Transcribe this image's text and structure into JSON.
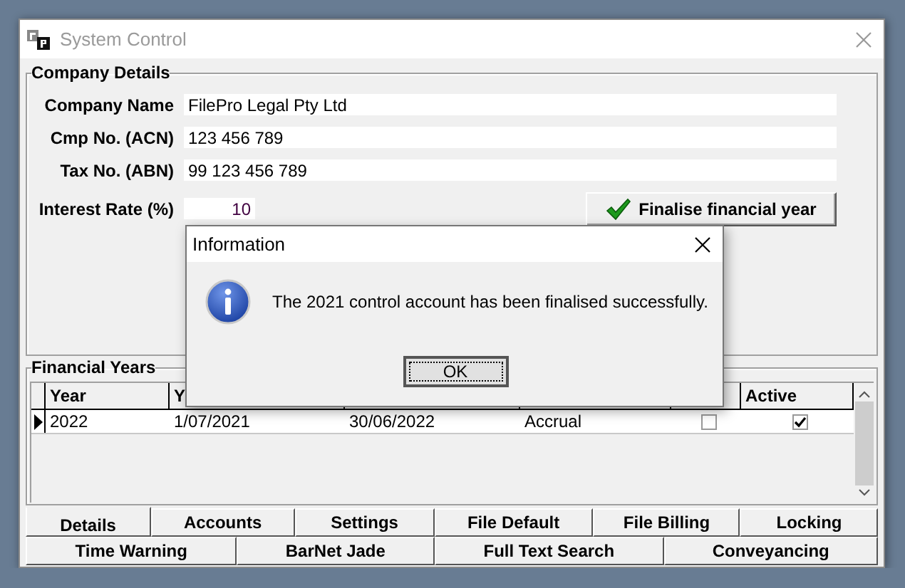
{
  "window": {
    "title": "System Control"
  },
  "company_details": {
    "title": "Company Details",
    "fields": [
      {
        "label": "Company Name",
        "value": "FilePro Legal Pty Ltd",
        "kind": "wide"
      },
      {
        "label": "Cmp No. (ACN)",
        "value": "123 456 789",
        "kind": "wide"
      },
      {
        "label": "Tax No. (ABN)",
        "value": "99 123 456 789",
        "kind": "wide"
      },
      {
        "label": "Interest Rate (%)",
        "value": "10",
        "kind": "number"
      }
    ],
    "finalise_button": {
      "label": "Finalise financial year"
    }
  },
  "financial_years": {
    "title": "Financial Years",
    "columns": [
      {
        "header": "Year"
      },
      {
        "header": "Y"
      },
      {},
      {},
      {},
      {
        "header": "Active"
      }
    ],
    "rows": [
      {
        "current": true,
        "cells": [
          {
            "kind": "text",
            "text": "2022"
          },
          {
            "kind": "text",
            "text": "1/07/2021"
          },
          {
            "kind": "text",
            "text": "30/06/2022"
          },
          {
            "kind": "text",
            "text": "Accrual"
          },
          {
            "kind": "check",
            "checked": false
          },
          {
            "kind": "check",
            "checked": true
          }
        ]
      }
    ]
  },
  "tab_rows": [
    [
      {
        "label": "Details",
        "selected": true
      },
      {
        "label": "Accounts",
        "selected": false
      },
      {
        "label": "Settings",
        "selected": false
      },
      {
        "label": "File Default",
        "selected": false
      },
      {
        "label": "File Billing",
        "selected": false
      },
      {
        "label": "Locking",
        "selected": false
      }
    ],
    [
      {
        "label": "Time Warning",
        "selected": false
      },
      {
        "label": "BarNet Jade",
        "selected": false
      },
      {
        "label": "Full Text Search",
        "selected": false
      },
      {
        "label": "Conveyancing",
        "selected": false
      }
    ]
  ],
  "dialog": {
    "title": "Information",
    "message": "The 2021 control account has been finalised successfully.",
    "button": "OK"
  }
}
